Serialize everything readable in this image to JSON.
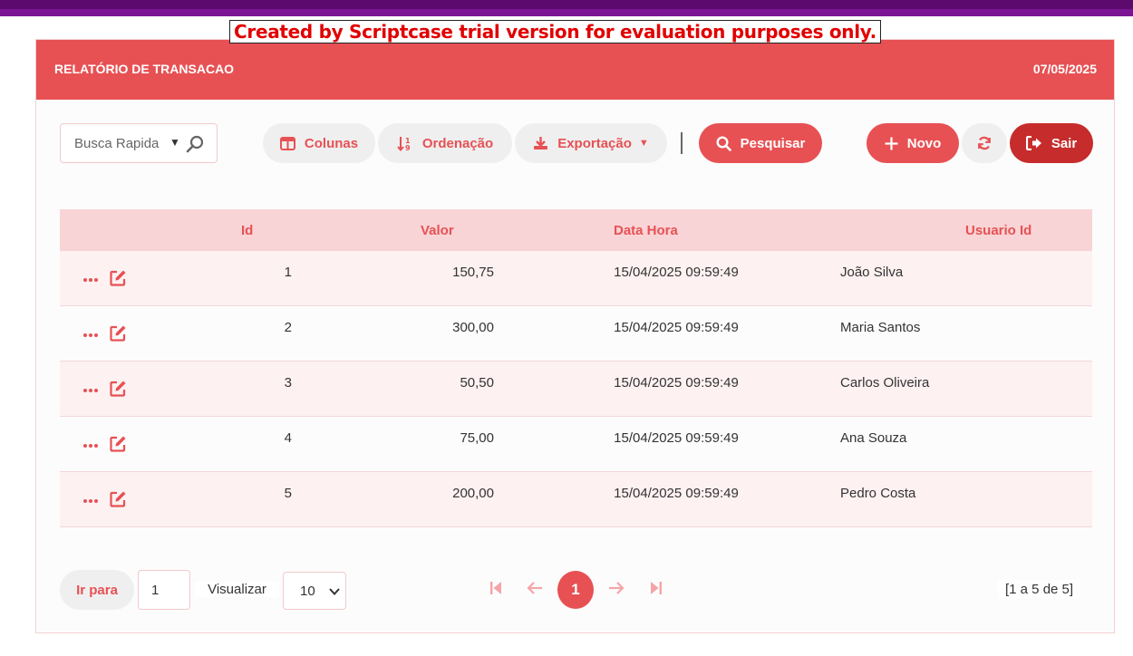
{
  "banner": {
    "trial_text": "Created by Scriptcase trial version for evaluation purposes only."
  },
  "header": {
    "title": "RELATÓRIO DE TRANSACAO",
    "date": "07/05/2025"
  },
  "toolbar": {
    "quick_search_placeholder": "Busca Rapida",
    "columns_label": "Colunas",
    "sort_label": "Ordenação",
    "export_label": "Exportação",
    "search_label": "Pesquisar",
    "new_label": "Novo",
    "exit_label": "Sair"
  },
  "table": {
    "columns": [
      "Id",
      "Valor",
      "Data Hora",
      "Usuario Id"
    ],
    "rows": [
      {
        "id": "1",
        "valor": "150,75",
        "data_hora": "15/04/2025 09:59:49",
        "usuario": "João Silva"
      },
      {
        "id": "2",
        "valor": "300,00",
        "data_hora": "15/04/2025 09:59:49",
        "usuario": "Maria Santos"
      },
      {
        "id": "3",
        "valor": "50,50",
        "data_hora": "15/04/2025 09:59:49",
        "usuario": "Carlos Oliveira"
      },
      {
        "id": "4",
        "valor": "75,00",
        "data_hora": "15/04/2025 09:59:49",
        "usuario": "Ana Souza"
      },
      {
        "id": "5",
        "valor": "200,00",
        "data_hora": "15/04/2025 09:59:49",
        "usuario": "Pedro Costa"
      }
    ]
  },
  "footer": {
    "goto_label": "Ir para",
    "goto_value": "1",
    "view_label": "Visualizar",
    "per_page": "10",
    "current_page": "1",
    "summary": "[1 a 5 de 5]"
  },
  "colors": {
    "accent": "#e75154",
    "dark_accent": "#c62c2c",
    "top_bar": "#5c0a6e",
    "row_alt": "#fdf1f2"
  },
  "icons": [
    "search-icon",
    "caret-down-icon",
    "columns-icon",
    "sort-icon",
    "download-icon",
    "plus-icon",
    "refresh-icon",
    "logout-icon",
    "more-icon",
    "edit-icon",
    "first-page-icon",
    "prev-page-icon",
    "next-page-icon",
    "last-page-icon",
    "chevron-down-icon"
  ]
}
